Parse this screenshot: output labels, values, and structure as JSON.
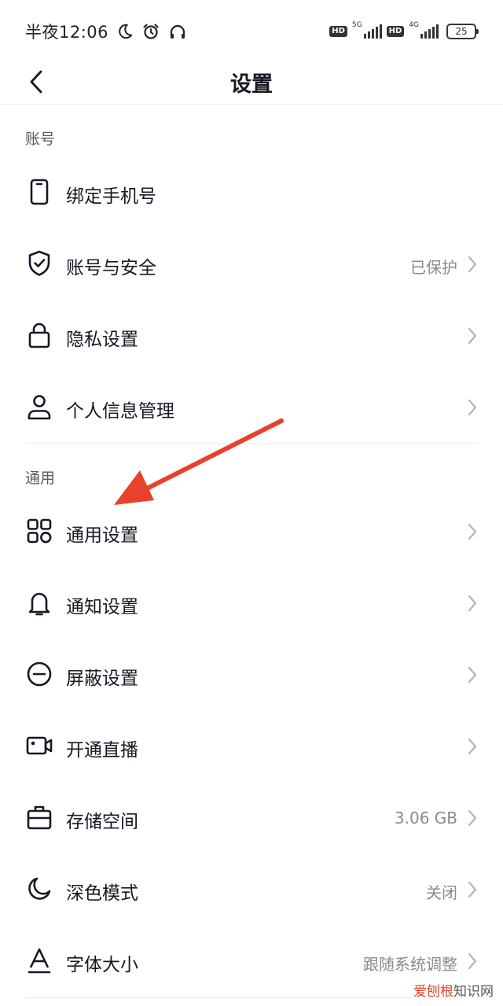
{
  "status_bar": {
    "time": "半夜12:06",
    "net1": "5G",
    "net2": "4G",
    "battery": "25"
  },
  "nav": {
    "title": "设置"
  },
  "sections": {
    "account_header": "账号",
    "general_header": "通用"
  },
  "account_items": [
    {
      "label": "绑定手机号",
      "icon": "phone-icon"
    },
    {
      "label": "账号与安全",
      "value": "已保护",
      "icon": "shield-check-icon"
    },
    {
      "label": "隐私设置",
      "icon": "lock-icon"
    },
    {
      "label": "个人信息管理",
      "icon": "person-icon"
    }
  ],
  "general_items": [
    {
      "label": "通用设置",
      "icon": "grid-icon"
    },
    {
      "label": "通知设置",
      "icon": "bell-icon"
    },
    {
      "label": "屏蔽设置",
      "icon": "minus-circle-icon"
    },
    {
      "label": "开通直播",
      "icon": "video-camera-icon"
    },
    {
      "label": "存储空间",
      "value": "3.06 GB",
      "icon": "storage-box-icon"
    },
    {
      "label": "深色模式",
      "value": "关闭",
      "icon": "moon-icon"
    },
    {
      "label": "字体大小",
      "value": "跟随系统调整",
      "icon": "font-size-icon"
    }
  ],
  "annotation": {
    "color": "#e8412c"
  },
  "watermark": {
    "brand": "爱刨根",
    "suffix": "知识网"
  }
}
